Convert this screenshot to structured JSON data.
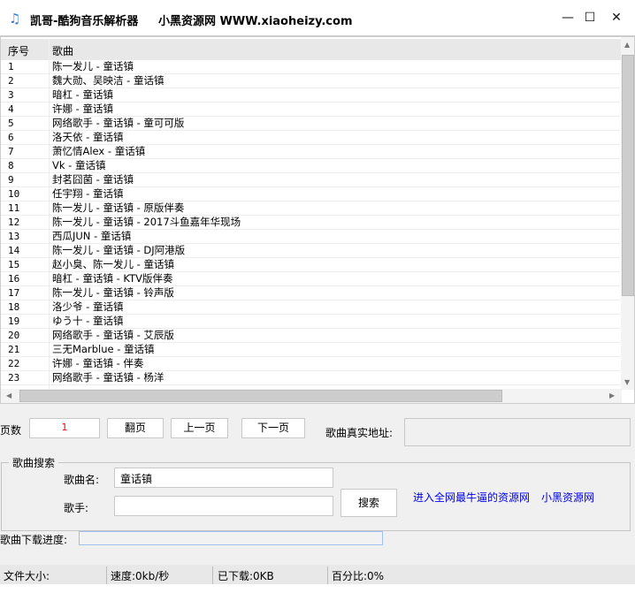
{
  "window": {
    "title": "凯哥-酷狗音乐解析器     小黑资源网 WWW.xiaoheizy.com",
    "icon": "music-note-icon",
    "minimize": "—",
    "maximize": "☐",
    "close": "✕"
  },
  "table": {
    "columns": [
      "序号",
      "歌曲"
    ],
    "rows": [
      [
        "1",
        "陈一发儿 - 童话镇"
      ],
      [
        "2",
        "魏大勋、吴映洁 - 童话镇"
      ],
      [
        "3",
        "暗杠 - 童话镇"
      ],
      [
        "4",
        "许娜 - 童话镇"
      ],
      [
        "5",
        "网络歌手 - 童话镇 - 童可可版"
      ],
      [
        "6",
        "洛天依 - 童话镇"
      ],
      [
        "7",
        "萧忆情Alex - 童话镇"
      ],
      [
        "8",
        "Vk - 童话镇"
      ],
      [
        "9",
        "封茗囧菌 - 童话镇"
      ],
      [
        "10",
        "任宇翔 - 童话镇"
      ],
      [
        "11",
        "陈一发儿 - 童话镇 - 原版伴奏"
      ],
      [
        "12",
        "陈一发儿 - 童话镇 - 2017斗鱼嘉年华现场"
      ],
      [
        "13",
        "西瓜JUN - 童话镇"
      ],
      [
        "14",
        "陈一发儿 - 童话镇 - DJ阿港版"
      ],
      [
        "15",
        "赵小臭、陈一发儿 - 童话镇"
      ],
      [
        "16",
        "暗杠 - 童话镇 - KTV版伴奏"
      ],
      [
        "17",
        "陈一发儿 - 童话镇 - 铃声版"
      ],
      [
        "18",
        "洛少爷 - 童话镇"
      ],
      [
        "19",
        "ゆう十 - 童话镇"
      ],
      [
        "20",
        "网络歌手 - 童话镇 - 艾辰版"
      ],
      [
        "21",
        "三无Marblue - 童话镇"
      ],
      [
        "22",
        "许娜 - 童话镇 - 伴奏"
      ],
      [
        "23",
        "网络歌手 - 童话镇 - 杨洋"
      ]
    ]
  },
  "paging": {
    "label": "页数",
    "value": "1",
    "flip": "翻页",
    "prev": "上一页",
    "next": "下一页",
    "real_url_label": "歌曲真实地址:",
    "real_url_value": ""
  },
  "search": {
    "group_label": "歌曲搜索",
    "song_label": "歌曲名:",
    "song_value": "童话镇",
    "singer_label": "歌手:",
    "singer_value": "",
    "search_button": "搜索",
    "link1": "进入全网最牛逼的资源网",
    "link2": "小黑资源网"
  },
  "download": {
    "label": "歌曲下载进度:",
    "progress": 0
  },
  "status": {
    "size": "文件大小:",
    "speed": "速度:0kb/秒",
    "downloaded": "已下载:0KB",
    "percent": "百分比:0%"
  }
}
